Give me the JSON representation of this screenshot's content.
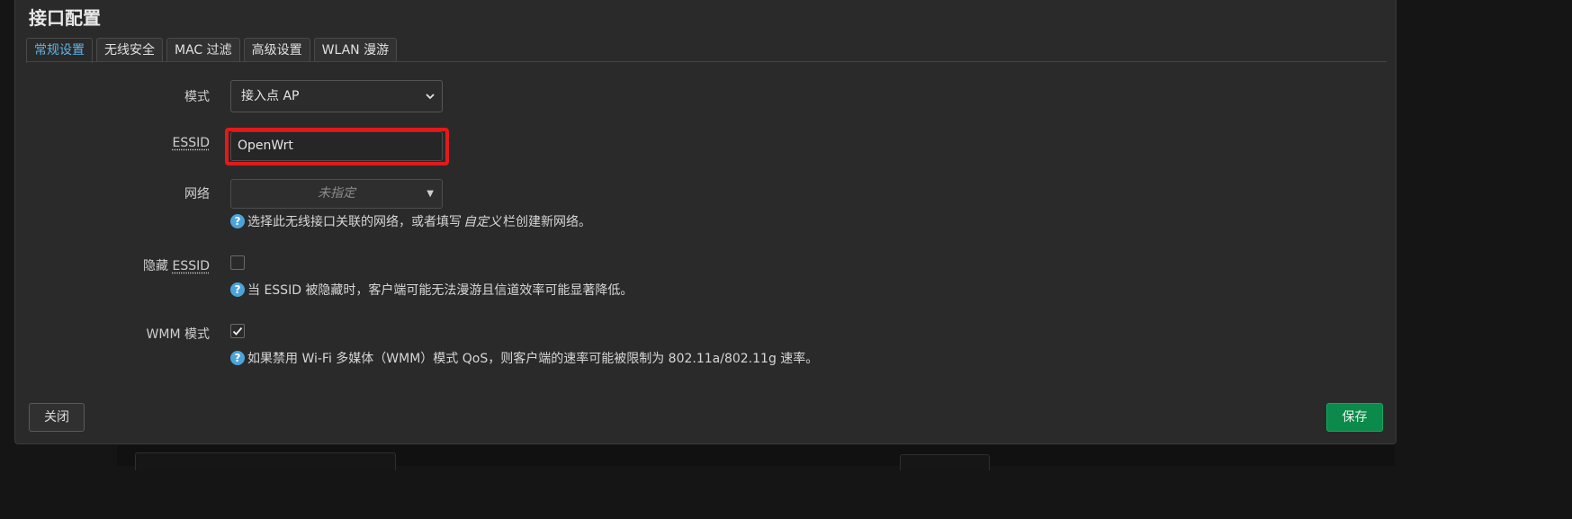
{
  "title": "接口配置",
  "tabs": [
    {
      "label": "常规设置",
      "active": true
    },
    {
      "label": "无线安全",
      "active": false
    },
    {
      "label": "MAC 过滤",
      "active": false
    },
    {
      "label": "高级设置",
      "active": false
    },
    {
      "label": "WLAN 漫游",
      "active": false
    }
  ],
  "form": {
    "mode": {
      "label": "模式",
      "value": "接入点 AP"
    },
    "essid": {
      "label": "ESSID",
      "value": "OpenWrt"
    },
    "network": {
      "label": "网络",
      "value": "未指定",
      "help_before": "选择此无线接口关联的网络，或者填写",
      "help_em": "自定义",
      "help_after": "栏创建新网络。"
    },
    "hide_essid": {
      "label_prefix": "隐藏",
      "label_abbr": "ESSID",
      "checked": false,
      "help": "当 ESSID 被隐藏时，客户端可能无法漫游且信道效率可能显著降低。"
    },
    "wmm": {
      "label": "WMM 模式",
      "checked": true,
      "help": "如果禁用 Wi-Fi 多媒体（WMM）模式 QoS，则客户端的速率可能被限制为 802.11a/802.11g 速率。"
    }
  },
  "buttons": {
    "close": "关闭",
    "save": "保存"
  },
  "colors": {
    "accent_tab": "#5fb4e5",
    "highlight": "#e21a1a",
    "save": "#0b8a4c",
    "help_icon": "#4aa3d9"
  }
}
